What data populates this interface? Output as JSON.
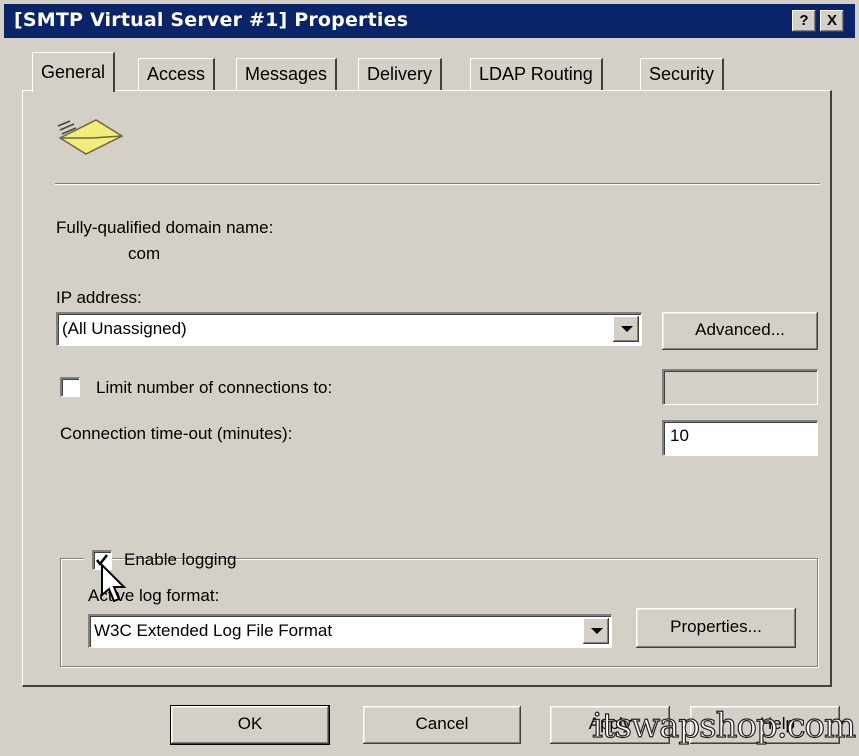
{
  "window": {
    "title": "[SMTP Virtual Server #1] Properties",
    "help_glyph": "?",
    "close_glyph": "X"
  },
  "tabs": [
    {
      "label": "General",
      "active": true
    },
    {
      "label": "Access"
    },
    {
      "label": "Messages"
    },
    {
      "label": "Delivery"
    },
    {
      "label": "LDAP Routing"
    },
    {
      "label": "Security"
    }
  ],
  "general": {
    "icon": "envelope-icon",
    "fqdn_label": "Fully-qualified domain name:",
    "fqdn_value": "com",
    "ip_label": "IP address:",
    "ip_value": "(All Unassigned)",
    "advanced_button": "Advanced...",
    "limit_connections_label": "Limit number of connections to:",
    "limit_connections_checked": false,
    "limit_connections_value": "",
    "timeout_label": "Connection time-out (minutes):",
    "timeout_value": "10",
    "logging": {
      "enable_label": "Enable logging",
      "enabled": true,
      "format_label": "Active log format:",
      "format_value": "W3C Extended Log File Format",
      "properties_button": "Properties..."
    }
  },
  "footer": {
    "ok": "OK",
    "cancel": "Cancel",
    "apply": "Apply",
    "help": "Help"
  },
  "watermark": "itswapshop.com"
}
